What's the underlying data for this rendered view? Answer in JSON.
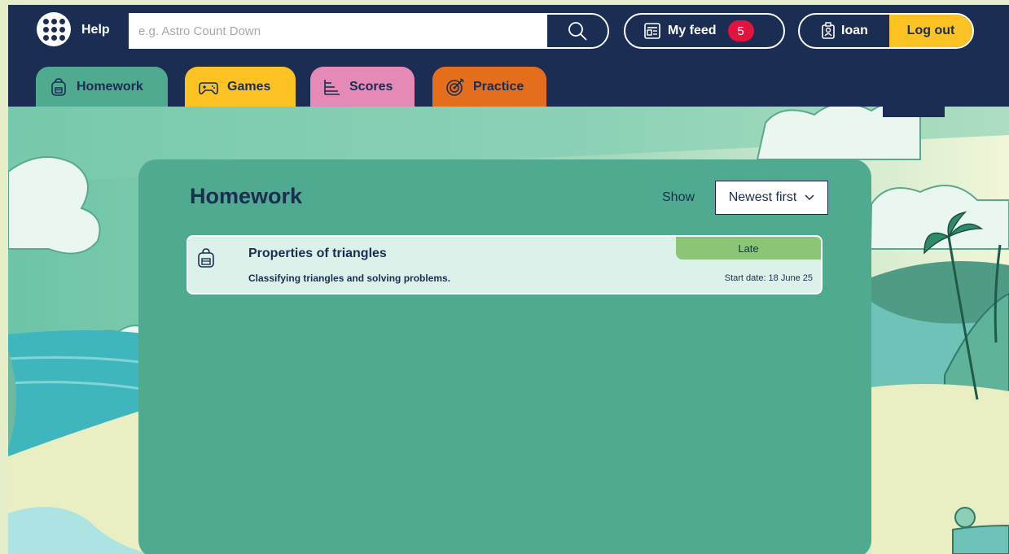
{
  "header": {
    "help_label": "Help",
    "search": {
      "placeholder": "e.g. Astro Count Down",
      "value": ""
    },
    "feed": {
      "label": "My feed",
      "count": "5"
    },
    "user": {
      "name": "Ioan"
    },
    "logout_label": "Log out"
  },
  "tabs": [
    {
      "label": "Homework",
      "color": "#4faa8f",
      "active": true
    },
    {
      "label": "Games",
      "color": "#fdc224"
    },
    {
      "label": "Scores",
      "color": "#e589b7"
    },
    {
      "label": "Practice",
      "color": "#e46e1b"
    }
  ],
  "main": {
    "title": "Homework",
    "show_label": "Show",
    "sort": {
      "selected": "Newest first"
    },
    "homework_items": [
      {
        "title": "Properties of triangles",
        "description": "Classifying triangles and solving problems.",
        "status": "Late",
        "start_date": "Start date: 18 June 25"
      }
    ]
  },
  "colors": {
    "navy": "#1b2d52",
    "accent_yellow": "#fdc224",
    "badge_red": "#e0143c",
    "late_green": "#8bc677"
  }
}
